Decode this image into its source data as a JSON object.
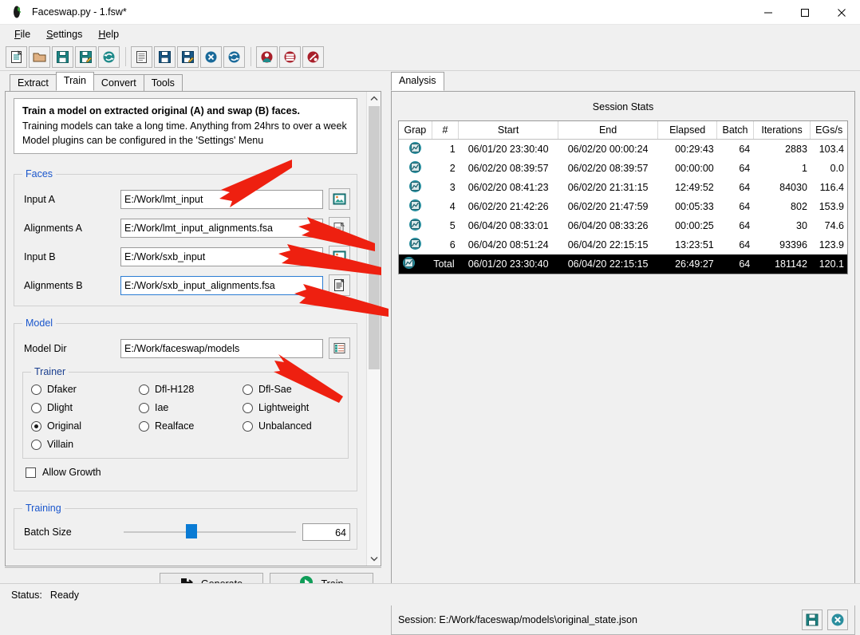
{
  "window": {
    "title": "Faceswap.py - 1.fsw*",
    "icon": "faceswap-logo-icon",
    "controls": {
      "minimize": "—",
      "maximize": "□",
      "close": "✕"
    }
  },
  "menubar": {
    "items": [
      {
        "label": "File",
        "mnemonic": "F"
      },
      {
        "label": "Settings",
        "mnemonic": "S"
      },
      {
        "label": "Help",
        "mnemonic": "H"
      }
    ]
  },
  "toolbar": {
    "groups": [
      [
        "new-project-icon",
        "open-folder-icon",
        "save-project-icon",
        "save-project-as-icon",
        "reload-project-icon"
      ],
      [
        "new-task-icon",
        "save-task-icon",
        "save-task-as-icon",
        "clear-task-icon",
        "reload-task-icon"
      ],
      [
        "extract-faces-icon",
        "alignments-tool-icon",
        "effmpeg-tool-icon"
      ]
    ]
  },
  "left_panel": {
    "tabs": [
      {
        "label": "Extract",
        "active": false
      },
      {
        "label": "Train",
        "active": true
      },
      {
        "label": "Convert",
        "active": false
      },
      {
        "label": "Tools",
        "active": false
      }
    ],
    "info": {
      "heading": "Train a model on extracted original (A) and swap (B) faces.",
      "line1": "Training models can take a long time. Anything from 24hrs to over a week",
      "line2": "Model plugins can be configured in the 'Settings' Menu"
    },
    "faces": {
      "legend": "Faces",
      "fields": [
        {
          "label": "Input A",
          "value": "E:/Work/lmt_input",
          "browse": "image-folder-icon",
          "focused": false
        },
        {
          "label": "Alignments A",
          "value": "E:/Work/lmt_input_alignments.fsa",
          "browse": "file-page-icon",
          "focused": false
        },
        {
          "label": "Input B",
          "value": "E:/Work/sxb_input",
          "browse": "image-folder-icon",
          "focused": false
        },
        {
          "label": "Alignments B",
          "value": "E:/Work/sxb_input_alignments.fsa",
          "browse": "file-doc-icon",
          "focused": true
        }
      ]
    },
    "model": {
      "legend": "Model",
      "dir_label": "Model Dir",
      "dir_value": "E:/Work/faceswap/models",
      "dir_browse": "folder-list-icon",
      "trainer": {
        "legend": "Trainer",
        "selected": "Original",
        "options": [
          "Dfaker",
          "Dfl-H128",
          "Dfl-Sae",
          "Dlight",
          "Iae",
          "Lightweight",
          "Original",
          "Realface",
          "Unbalanced",
          "Villain"
        ]
      },
      "allow_growth": {
        "label": "Allow Growth",
        "checked": false
      }
    },
    "training": {
      "legend": "Training",
      "batch_size": {
        "label": "Batch Size",
        "value": "64",
        "slider_percent": 36
      }
    },
    "buttons": [
      {
        "label": "Generate",
        "icon": "generate-arrow-icon"
      },
      {
        "label": "Train",
        "icon": "play-circle-icon"
      }
    ]
  },
  "right_panel": {
    "tabs": [
      {
        "label": "Analysis",
        "active": true
      }
    ],
    "session_stats": {
      "title": "Session Stats",
      "columns": [
        "Grap",
        "#",
        "Start",
        "End",
        "Elapsed",
        "Batch",
        "Iterations",
        "EGs/s"
      ],
      "rows": [
        {
          "graph": "graph-icon",
          "num": "1",
          "start": "06/01/20 23:30:40",
          "end": "06/02/20 00:00:24",
          "elapsed": "00:29:43",
          "batch": "64",
          "iterations": "2883",
          "egs": "103.4",
          "total": false
        },
        {
          "graph": "graph-icon",
          "num": "2",
          "start": "06/02/20 08:39:57",
          "end": "06/02/20 08:39:57",
          "elapsed": "00:00:00",
          "batch": "64",
          "iterations": "1",
          "egs": "0.0",
          "total": false
        },
        {
          "graph": "graph-icon",
          "num": "3",
          "start": "06/02/20 08:41:23",
          "end": "06/02/20 21:31:15",
          "elapsed": "12:49:52",
          "batch": "64",
          "iterations": "84030",
          "egs": "116.4",
          "total": false
        },
        {
          "graph": "graph-icon",
          "num": "4",
          "start": "06/02/20 21:42:26",
          "end": "06/02/20 21:47:59",
          "elapsed": "00:05:33",
          "batch": "64",
          "iterations": "802",
          "egs": "153.9",
          "total": false
        },
        {
          "graph": "graph-icon",
          "num": "5",
          "start": "06/04/20 08:33:01",
          "end": "06/04/20 08:33:26",
          "elapsed": "00:00:25",
          "batch": "64",
          "iterations": "30",
          "egs": "74.6",
          "total": false
        },
        {
          "graph": "graph-icon",
          "num": "6",
          "start": "06/04/20 08:51:24",
          "end": "06/04/20 22:15:15",
          "elapsed": "13:23:51",
          "batch": "64",
          "iterations": "93396",
          "egs": "123.9",
          "total": false
        },
        {
          "graph": "graph-icon",
          "num": "Total",
          "start": "06/01/20 23:30:40",
          "end": "06/04/20 22:15:15",
          "elapsed": "26:49:27",
          "batch": "64",
          "iterations": "181142",
          "egs": "120.1",
          "total": true
        }
      ]
    },
    "session_bar": {
      "text": "Session: E:/Work/faceswap/models\\original_state.json",
      "save_icon": "save-session-icon",
      "close_icon": "close-session-icon"
    }
  },
  "statusbar": {
    "label": "Status:",
    "value": "Ready"
  },
  "colors": {
    "accent_blue": "#1a56cc",
    "teal": "#1f8a8a",
    "annotation_red": "#ee2010",
    "slider_blue": "#0a7bd4",
    "train_green": "#0f9d58"
  }
}
